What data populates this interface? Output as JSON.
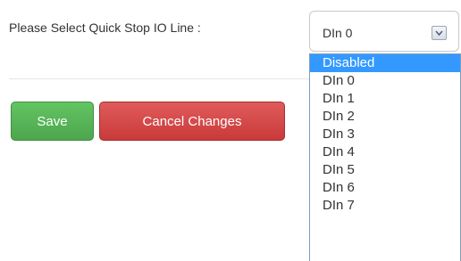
{
  "form": {
    "label": "Please Select Quick Stop IO Line :",
    "selected_value": "DIn 0"
  },
  "dropdown": {
    "options": [
      "Disabled",
      "DIn 0",
      "DIn 1",
      "DIn 2",
      "DIn 3",
      "DIn 4",
      "DIn 5",
      "DIn 6",
      "DIn 7"
    ],
    "highlighted": "Disabled"
  },
  "buttons": {
    "save_label": "Save",
    "cancel_label": "Cancel Changes"
  },
  "colors": {
    "save": "#5cb85c",
    "cancel": "#d9534f",
    "highlight": "#3399ff"
  },
  "icons": {
    "select_arrow": "chevron-down-icon"
  }
}
